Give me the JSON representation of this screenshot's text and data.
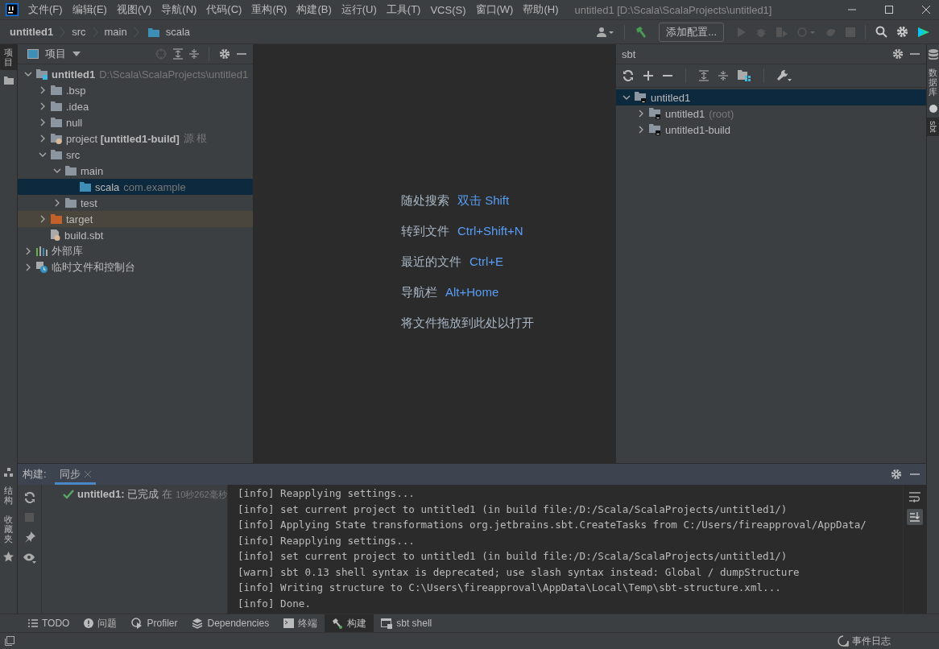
{
  "menu": [
    "文件(F)",
    "编辑(E)",
    "视图(V)",
    "导航(N)",
    "代码(C)",
    "重构(R)",
    "构建(B)",
    "运行(U)",
    "工具(T)",
    "VCS(S)",
    "窗口(W)",
    "帮助(H)"
  ],
  "window": {
    "title": "untitled1 [D:\\Scala\\ScalaProjects\\untitled1]"
  },
  "breadcrumbs": [
    {
      "label": "untitled1",
      "kind": "project"
    },
    {
      "label": "src",
      "kind": "dir"
    },
    {
      "label": "main",
      "kind": "dir"
    },
    {
      "label": "scala",
      "kind": "source"
    }
  ],
  "toolbar": {
    "config_button": "添加配置..."
  },
  "left_strip": [
    {
      "label": "项目",
      "selected": true
    },
    {
      "label": "结构",
      "selected": false
    },
    {
      "label": "收藏夹",
      "selected": false
    }
  ],
  "right_strip": [
    {
      "label": "数据库",
      "selected": false
    },
    {
      "label": "sbt",
      "selected": true
    }
  ],
  "project_panel": {
    "title": "项目",
    "tree": [
      {
        "label": "untitled1",
        "hint": "D:\\Scala\\ScalaProjects\\untitled1",
        "kind": "module",
        "expanded": true,
        "selected": false,
        "children": [
          {
            "label": ".bsp",
            "kind": "folder",
            "expanded": false,
            "selected": false
          },
          {
            "label": ".idea",
            "kind": "folder",
            "expanded": false,
            "selected": false
          },
          {
            "label": "null",
            "kind": "folder",
            "expanded": false,
            "selected": false
          },
          {
            "label": "project **[untitled1-build]**",
            "hint": "源 根",
            "kind": "sbt-folder",
            "expanded": false,
            "selected": false
          },
          {
            "label": "src",
            "kind": "folder",
            "expanded": true,
            "selected": false,
            "children": [
              {
                "label": "main",
                "kind": "folder",
                "expanded": true,
                "selected": false,
                "children": [
                  {
                    "label": "scala",
                    "hint": "com.example",
                    "kind": "source",
                    "selected": true
                  }
                ]
              },
              {
                "label": "test",
                "kind": "folder",
                "expanded": false,
                "selected": false
              }
            ]
          },
          {
            "label": "target",
            "kind": "excluded",
            "expanded": false,
            "selected": false
          },
          {
            "label": "build.sbt",
            "kind": "sbt-file",
            "selected": false
          }
        ]
      },
      {
        "label": "外部库",
        "kind": "library",
        "expanded": false,
        "selected": false
      },
      {
        "label": "临时文件和控制台",
        "kind": "scratch",
        "expanded": false,
        "selected": false
      }
    ]
  },
  "editor_hints": [
    {
      "label": "随处搜索",
      "shortcut": "双击 Shift"
    },
    {
      "label": "转到文件",
      "shortcut": "Ctrl+Shift+N"
    },
    {
      "label": "最近的文件",
      "shortcut": "Ctrl+E"
    },
    {
      "label": "导航栏",
      "shortcut": "Alt+Home"
    },
    {
      "label": "将文件拖放到此处以打开"
    }
  ],
  "sbt_panel": {
    "title": "sbt",
    "tree": [
      {
        "label": "untitled1",
        "expanded": true,
        "selected": true,
        "children": [
          {
            "label": "untitled1",
            "hint": "(root)",
            "expanded": false,
            "selected": false
          },
          {
            "label": "untitled1-build",
            "expanded": false,
            "selected": false
          }
        ]
      }
    ]
  },
  "build_panel": {
    "title": "构建:",
    "tabs": [
      {
        "label": "同步",
        "selected": true
      }
    ],
    "result": {
      "status": "**untitled1:** 已完成",
      "at": "在",
      "duration": "10秒262毫秒"
    },
    "console": [
      "[info] Reapplying settings...",
      "[info] set current project to untitled1 (in build file:/D:/Scala/ScalaProjects/untitled1/)",
      "[info] Applying State transformations org.jetbrains.sbt.CreateTasks from C:/Users/fireapproval/AppData/",
      "[info] Reapplying settings...",
      "[info] set current project to untitled1 (in build file:/D:/Scala/ScalaProjects/untitled1/)",
      "[warn] sbt 0.13 shell syntax is deprecated; use slash syntax instead: Global / dumpStructure",
      "[info] Writing structure to C:\\Users\\fireapproval\\AppData\\Local\\Temp\\sbt-structure.xml...",
      "[info] Done."
    ]
  },
  "tool_tabs": [
    {
      "label": "TODO",
      "kind": "list",
      "selected": false
    },
    {
      "label": "问题",
      "kind": "problem",
      "selected": false
    },
    {
      "label": "Profiler",
      "kind": "profiler",
      "selected": false
    },
    {
      "label": "Dependencies",
      "kind": "layers",
      "selected": false
    },
    {
      "label": "终端",
      "kind": "terminal",
      "selected": false
    },
    {
      "label": "构建",
      "kind": "build",
      "selected": true
    },
    {
      "label": "sbt shell",
      "kind": "shell",
      "selected": false
    }
  ],
  "status_bar": {
    "event_log": "事件日志"
  }
}
